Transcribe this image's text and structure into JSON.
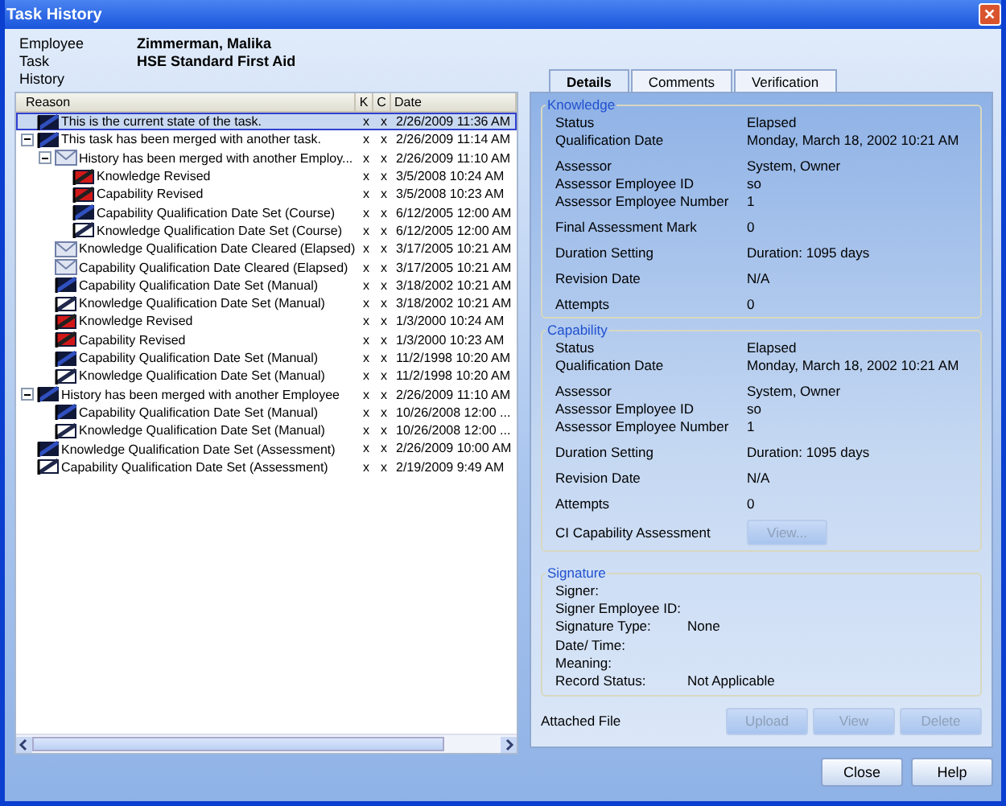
{
  "window": {
    "title": "Task History",
    "close": "✕"
  },
  "header": [
    {
      "label": "Employee",
      "value": "Zimmerman, Malika"
    },
    {
      "label": "Task",
      "value": "HSE  Standard First Aid"
    },
    {
      "label": "History"
    }
  ],
  "tree": {
    "columns": [
      "Reason",
      "K",
      "C",
      "Date"
    ],
    "rows": [
      {
        "reason": "This is the current state of the task.",
        "kind": "dark",
        "k": "x",
        "c": "x",
        "date": "2/26/2009 11:36 AM",
        "selected": true
      },
      {
        "reason": "This task has been merged with another task.",
        "kind": "dark",
        "k": "x",
        "c": "x",
        "date": "2/26/2009 11:14 AM",
        "selected": false,
        "expanded": true,
        "children": [
          {
            "reason": "History has been merged with another Employ...",
            "kind": "mail",
            "k": "x",
            "c": "x",
            "date": "2/26/2009 11:10 AM",
            "selected": false,
            "expanded": true,
            "children": [
              {
                "reason": "Knowledge Revised",
                "kind": "red",
                "k": "x",
                "c": "x",
                "date": "3/5/2008 10:24 AM",
                "selected": false
              },
              {
                "reason": "Capability Revised",
                "kind": "red",
                "k": "x",
                "c": "x",
                "date": "3/5/2008 10:23 AM",
                "selected": false
              },
              {
                "reason": "Capability Qualification Date Set (Course)",
                "kind": "dark",
                "k": "x",
                "c": "x",
                "date": "6/12/2005 12:00 AM",
                "selected": false
              },
              {
                "reason": "Knowledge Qualification Date Set (Course)",
                "kind": "light",
                "k": "x",
                "c": "x",
                "date": "6/12/2005 12:00 AM",
                "selected": false
              }
            ]
          },
          {
            "reason": "Knowledge Qualification Date Cleared (Elapsed)",
            "kind": "mail",
            "k": "x",
            "c": "x",
            "date": "3/17/2005 10:21 AM",
            "selected": false
          },
          {
            "reason": "Capability Qualification Date Cleared (Elapsed)",
            "kind": "mail",
            "k": "x",
            "c": "x",
            "date": "3/17/2005 10:21 AM",
            "selected": false
          },
          {
            "reason": "Capability Qualification Date Set (Manual)",
            "kind": "dark",
            "k": "x",
            "c": "x",
            "date": "3/18/2002 10:21 AM",
            "selected": false
          },
          {
            "reason": "Knowledge Qualification Date Set (Manual)",
            "kind": "light",
            "k": "x",
            "c": "x",
            "date": "3/18/2002 10:21 AM",
            "selected": false
          },
          {
            "reason": "Knowledge Revised",
            "kind": "red",
            "k": "x",
            "c": "x",
            "date": "1/3/2000 10:24 AM",
            "selected": false
          },
          {
            "reason": "Capability Revised",
            "kind": "red",
            "k": "x",
            "c": "x",
            "date": "1/3/2000 10:23 AM",
            "selected": false
          },
          {
            "reason": "Capability Qualification Date Set (Manual)",
            "kind": "dark",
            "k": "x",
            "c": "x",
            "date": "11/2/1998 10:20 AM",
            "selected": false
          },
          {
            "reason": "Knowledge Qualification Date Set (Manual)",
            "kind": "light",
            "k": "x",
            "c": "x",
            "date": "11/2/1998 10:20 AM",
            "selected": false
          }
        ]
      },
      {
        "reason": "History has been merged with another Employee",
        "kind": "dark",
        "k": "x",
        "c": "x",
        "date": "2/26/2009 11:10 AM",
        "selected": false,
        "expanded": true,
        "children": [
          {
            "reason": "Capability Qualification Date Set (Manual)",
            "kind": "dark",
            "k": "x",
            "c": "x",
            "date": "10/26/2008 12:00 ...",
            "selected": false
          },
          {
            "reason": "Knowledge Qualification Date Set (Manual)",
            "kind": "light",
            "k": "x",
            "c": "x",
            "date": "10/26/2008 12:00 ...",
            "selected": false
          }
        ]
      },
      {
        "reason": "Knowledge Qualification Date Set (Assessment)",
        "kind": "dark",
        "k": "x",
        "c": "x",
        "date": "2/26/2009 10:00 AM",
        "selected": false
      },
      {
        "reason": "Capability Qualification Date Set (Assessment)",
        "kind": "light",
        "k": "x",
        "c": "x",
        "date": "2/19/2009 9:49 AM",
        "selected": false
      }
    ]
  },
  "tabs": [
    {
      "label": "Details",
      "selected": true
    },
    {
      "label": "Comments",
      "selected": false
    },
    {
      "label": "Verification",
      "selected": false
    }
  ],
  "knowledge": {
    "title": "Knowledge",
    "groups": [
      [
        {
          "label": "Status",
          "value": "Elapsed"
        },
        {
          "label": "Qualification Date",
          "value": "Monday, March 18, 2002 10:21 AM"
        }
      ],
      [
        {
          "label": "Assessor",
          "value": "System, Owner"
        },
        {
          "label": "Assessor Employee ID",
          "value": "so"
        },
        {
          "label": "Assessor Employee Number",
          "value": "1"
        }
      ],
      [
        {
          "label": "Final Assessment Mark",
          "value": "0"
        }
      ],
      [
        {
          "label": "Duration Setting",
          "value": "Duration: 1095 days"
        }
      ],
      [
        {
          "label": "Revision Date",
          "value": "N/A"
        }
      ],
      [
        {
          "label": "Attempts",
          "value": "0"
        }
      ]
    ]
  },
  "capability": {
    "title": "Capability",
    "groups": [
      [
        {
          "label": "Status",
          "value": "Elapsed"
        },
        {
          "label": "Qualification Date",
          "value": "Monday, March 18, 2002 10:21 AM"
        }
      ],
      [
        {
          "label": "Assessor",
          "value": "System, Owner"
        },
        {
          "label": "Assessor Employee ID",
          "value": "so"
        },
        {
          "label": "Assessor Employee Number",
          "value": "1"
        }
      ],
      [
        {
          "label": "Duration Setting",
          "value": "Duration: 1095 days"
        }
      ],
      [
        {
          "label": "Revision Date",
          "value": "N/A"
        }
      ],
      [
        {
          "label": "Attempts",
          "value": "0"
        }
      ],
      [
        {
          "label": "CI Capability Assessment",
          "button": {
            "label": "View...",
            "disabled": true
          }
        }
      ]
    ]
  },
  "signature": {
    "title": "Signature",
    "fields": [
      {
        "label": "Signer:"
      },
      {
        "label": "Signer Employee ID:"
      },
      {
        "label": "Signature Type:",
        "value": "None"
      },
      {
        "label": "Date/ Time:"
      },
      {
        "label": "Meaning:"
      },
      {
        "label": "Record Status:",
        "value": "Not Applicable"
      }
    ]
  },
  "attached_file": {
    "label": "Attached File",
    "buttons": [
      {
        "label": "Upload",
        "disabled": true
      },
      {
        "label": "View",
        "disabled": true
      },
      {
        "label": "Delete",
        "disabled": true
      }
    ]
  },
  "footer_buttons": [
    {
      "label": "Close",
      "disabled": false
    },
    {
      "label": "Help",
      "disabled": false
    }
  ]
}
